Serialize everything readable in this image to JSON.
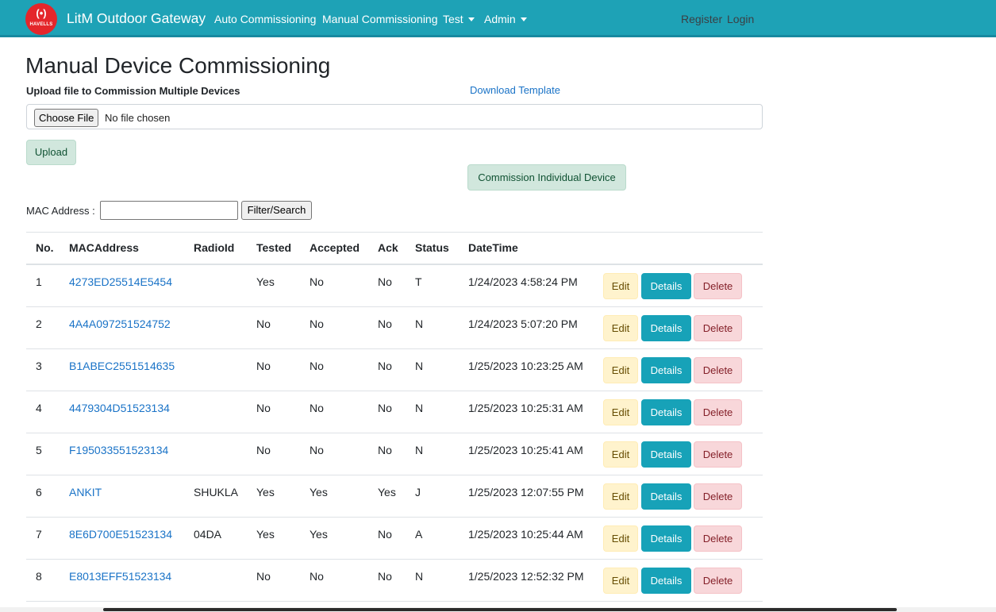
{
  "navbar": {
    "logo_text": "HAVELLS",
    "brand": "LitM Outdoor Gateway",
    "links": [
      "Auto Commissioning",
      "Manual Commissioning"
    ],
    "dropdowns": [
      "Test",
      "Admin"
    ],
    "register": "Register",
    "login": "Login",
    "bg_color": "#1ea2b6"
  },
  "page": {
    "title": "Manual Device Commissioning",
    "upload_label": "Upload file to Commission Multiple Devices",
    "download_template": "Download Template",
    "file_button": "Choose File",
    "file_status": "No file chosen",
    "upload_button": "Upload",
    "commission_button": "Commission Individual Device",
    "mac_label": "MAC Address :",
    "mac_value": "",
    "filter_button": "Filter/Search"
  },
  "table": {
    "headers": [
      "No.",
      "MACAddress",
      "RadioId",
      "Tested",
      "Accepted",
      "Ack",
      "Status",
      "DateTime"
    ],
    "actions": {
      "edit": "Edit",
      "details": "Details",
      "delete": "Delete"
    },
    "rows": [
      {
        "no": "1",
        "mac": "4273ED25514E5454",
        "radio": "",
        "tested": "Yes",
        "accepted": "No",
        "ack": "No",
        "status": "T",
        "datetime": "1/24/2023 4:58:24 PM"
      },
      {
        "no": "2",
        "mac": "4A4A097251524752",
        "radio": "",
        "tested": "No",
        "accepted": "No",
        "ack": "No",
        "status": "N",
        "datetime": "1/24/2023 5:07:20 PM"
      },
      {
        "no": "3",
        "mac": "B1ABEC2551514635",
        "radio": "",
        "tested": "No",
        "accepted": "No",
        "ack": "No",
        "status": "N",
        "datetime": "1/25/2023 10:23:25 AM"
      },
      {
        "no": "4",
        "mac": "4479304D51523134",
        "radio": "",
        "tested": "No",
        "accepted": "No",
        "ack": "No",
        "status": "N",
        "datetime": "1/25/2023 10:25:31 AM"
      },
      {
        "no": "5",
        "mac": "F195033551523134",
        "radio": "",
        "tested": "No",
        "accepted": "No",
        "ack": "No",
        "status": "N",
        "datetime": "1/25/2023 10:25:41 AM"
      },
      {
        "no": "6",
        "mac": "ANKIT",
        "radio": "SHUKLA",
        "tested": "Yes",
        "accepted": "Yes",
        "ack": "Yes",
        "status": "J",
        "datetime": "1/25/2023 12:07:55 PM"
      },
      {
        "no": "7",
        "mac": "8E6D700E51523134",
        "radio": "04DA",
        "tested": "Yes",
        "accepted": "Yes",
        "ack": "No",
        "status": "A",
        "datetime": "1/25/2023 10:25:44 AM"
      },
      {
        "no": "8",
        "mac": "E8013EFF51523134",
        "radio": "",
        "tested": "No",
        "accepted": "No",
        "ack": "No",
        "status": "N",
        "datetime": "1/25/2023 12:52:32 PM"
      }
    ]
  }
}
